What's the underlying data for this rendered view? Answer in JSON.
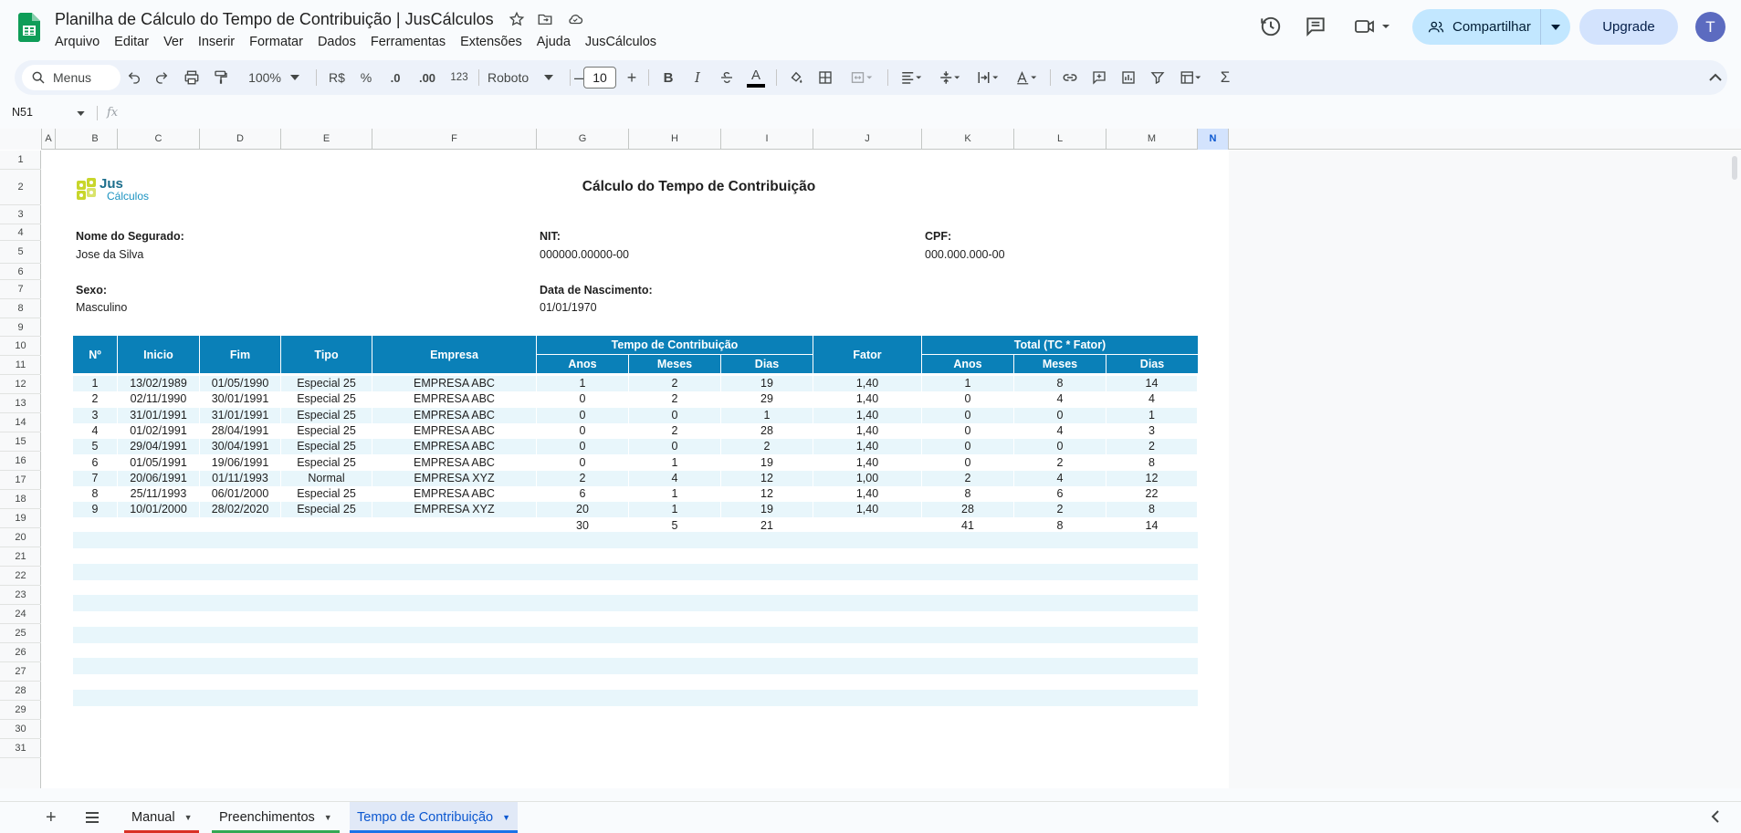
{
  "app": {
    "doc_title": "Planilha de Cálculo do Tempo de Contribuição | JusCálculos",
    "menu": [
      "Arquivo",
      "Editar",
      "Ver",
      "Inserir",
      "Formatar",
      "Dados",
      "Ferramentas",
      "Extensões",
      "Ajuda",
      "JusCálculos"
    ],
    "share_label": "Compartilhar",
    "upgrade_label": "Upgrade",
    "avatar_initial": "T"
  },
  "toolbar": {
    "search_label": "Menus",
    "zoom": "100%",
    "currency": "R$",
    "percent": "%",
    "dec_decrease": ".0",
    "dec_increase": ".00",
    "number_format": "123",
    "font": "Roboto",
    "font_size": "10",
    "bold": "B",
    "italic": "I",
    "text_color_label": "A"
  },
  "formula_bar": {
    "name_box": "N51",
    "fx": "fx"
  },
  "columns": [
    "A",
    "B",
    "C",
    "D",
    "E",
    "F",
    "G",
    "H",
    "I",
    "J",
    "K",
    "L",
    "M",
    "N"
  ],
  "rows": [
    "1",
    "2",
    "3",
    "4",
    "5",
    "6",
    "7",
    "8",
    "9",
    "10",
    "11",
    "12",
    "13",
    "14",
    "15",
    "16",
    "17",
    "18",
    "19",
    "20",
    "21",
    "22",
    "23",
    "24",
    "25",
    "26",
    "27",
    "28",
    "29",
    "30",
    "31"
  ],
  "sheet": {
    "title": "Cálculo do Tempo de Contribuição",
    "logo_jus": "Jus",
    "logo_calculos": "Cálculos",
    "name_label": "Nome do Segurado:",
    "name_value": "Jose da Silva",
    "nit_label": "NIT:",
    "nit_value": "000000.00000-00",
    "cpf_label": "CPF:",
    "cpf_value": "000.000.000-00",
    "sexo_label": "Sexo:",
    "sexo_value": "Masculino",
    "nasc_label": "Data de Nascimento:",
    "nasc_value": "01/01/1970"
  },
  "table": {
    "headers": {
      "n": "Nº",
      "inicio": "Inicio",
      "fim": "Fim",
      "tipo": "Tipo",
      "empresa": "Empresa",
      "tc": "Tempo de Contribuição",
      "fator": "Fator",
      "total": "Total (TC * Fator)",
      "anos": "Anos",
      "meses": "Meses",
      "dias": "Dias"
    },
    "rows": [
      [
        "1",
        "13/02/1989",
        "01/05/1990",
        "Especial 25",
        "EMPRESA ABC",
        "1",
        "2",
        "19",
        "1,40",
        "1",
        "8",
        "14"
      ],
      [
        "2",
        "02/11/1990",
        "30/01/1991",
        "Especial 25",
        "EMPRESA ABC",
        "0",
        "2",
        "29",
        "1,40",
        "0",
        "4",
        "4"
      ],
      [
        "3",
        "31/01/1991",
        "31/01/1991",
        "Especial 25",
        "EMPRESA ABC",
        "0",
        "0",
        "1",
        "1,40",
        "0",
        "0",
        "1"
      ],
      [
        "4",
        "01/02/1991",
        "28/04/1991",
        "Especial 25",
        "EMPRESA ABC",
        "0",
        "2",
        "28",
        "1,40",
        "0",
        "4",
        "3"
      ],
      [
        "5",
        "29/04/1991",
        "30/04/1991",
        "Especial 25",
        "EMPRESA ABC",
        "0",
        "0",
        "2",
        "1,40",
        "0",
        "0",
        "2"
      ],
      [
        "6",
        "01/05/1991",
        "19/06/1991",
        "Especial 25",
        "EMPRESA ABC",
        "0",
        "1",
        "19",
        "1,40",
        "0",
        "2",
        "8"
      ],
      [
        "7",
        "20/06/1991",
        "01/11/1993",
        "Normal",
        "EMPRESA XYZ",
        "2",
        "4",
        "12",
        "1,00",
        "2",
        "4",
        "12"
      ],
      [
        "8",
        "25/11/1993",
        "06/01/2000",
        "Especial 25",
        "EMPRESA ABC",
        "6",
        "1",
        "12",
        "1,40",
        "8",
        "6",
        "22"
      ],
      [
        "9",
        "10/01/2000",
        "28/02/2020",
        "Especial 25",
        "EMPRESA XYZ",
        "20",
        "1",
        "19",
        "1,40",
        "28",
        "2",
        "8"
      ]
    ],
    "totals": {
      "tc_anos": "30",
      "tc_meses": "5",
      "tc_dias": "21",
      "total_anos": "41",
      "total_meses": "8",
      "total_dias": "14"
    }
  },
  "tabs": [
    {
      "label": "Manual",
      "color": "#d93025"
    },
    {
      "label": "Preenchimentos",
      "color": "#34a853"
    },
    {
      "label": "Tempo de Contribuição",
      "color": "#1a73e8"
    }
  ],
  "colors": {
    "header_blue": "#0a80b8",
    "row_alt": "#e8f6fb",
    "accent": "#0b57d0"
  }
}
